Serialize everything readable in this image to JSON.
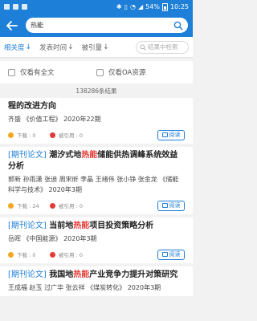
{
  "status": {
    "battery_percent": "54%",
    "time": "10:25"
  },
  "header": {
    "search_keyword": "热能"
  },
  "filters": {
    "items": [
      {
        "label": "相关度",
        "arrow": "↓",
        "active": true
      },
      {
        "label": "发表时间",
        "arrow": "↓",
        "active": false
      },
      {
        "label": "被引量",
        "arrow": "↓",
        "active": false
      }
    ],
    "in_results_placeholder": "结果中检索"
  },
  "checks": {
    "fulltext_label": "仅看有全文",
    "oa_label": "仅看OA资源"
  },
  "result_count": "138286条结果",
  "results": [
    {
      "tag": "",
      "title_before": "程的改进方向",
      "title_hl": "",
      "title_after": "",
      "authors": "齐盛   《价值工程》   2020年22期",
      "downloads": "下载 : 0",
      "citations": "被引用 : 0",
      "read_label": "阅读"
    },
    {
      "tag": "[期刊论文]",
      "title_before": "潮汐式地",
      "title_hl": "热能",
      "title_after": "储能供热调峰系统效益分析",
      "authors": "郭新 孙雨潇 张迪 周宋昕 李晶 王绪伟 张小铮 张金龙 《储能科学与技术》   2020年3期",
      "downloads": "下载 : 24",
      "citations": "被引用 : 0",
      "read_label": "阅读"
    },
    {
      "tag": "[期刊论文]",
      "title_before": "当前地",
      "title_hl": "热能",
      "title_after": "项目投资策略分析",
      "authors": "岳晖   《中国能源》   2020年3期",
      "downloads": "下载 : 0",
      "citations": "被引用 : 0",
      "read_label": "阅读"
    },
    {
      "tag": "[期刊论文]",
      "title_before": "我国地",
      "title_hl": "热能",
      "title_after": "产业竞争力提升对策研究",
      "authors": "王成福 赵玉 过广华 张云祥   《煤炭转化》   2020年3期",
      "downloads": "",
      "citations": "",
      "read_label": ""
    }
  ],
  "colors": {
    "primary": "#1e7fd8",
    "highlight": "#e53935",
    "download_dot": "#f5a623"
  }
}
